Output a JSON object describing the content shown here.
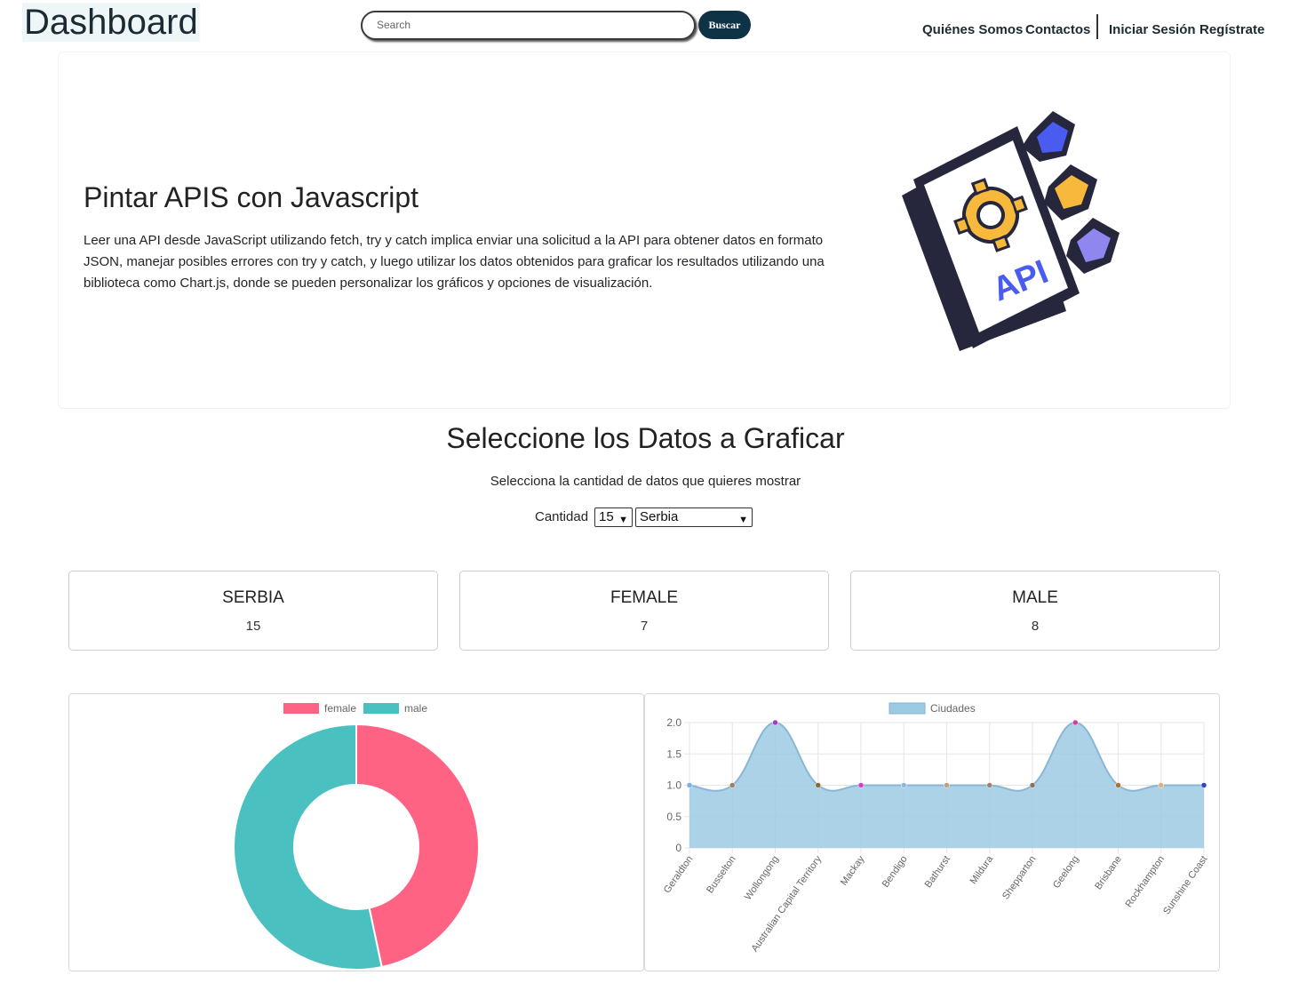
{
  "header": {
    "brand": "Dashboard",
    "search_placeholder": "Search",
    "search_button": "Buscar",
    "nav": [
      "Quiénes Somos",
      "Contactos",
      "Iniciar Sesión",
      "Regístrate"
    ]
  },
  "hero": {
    "title": "Pintar APIS con Javascript",
    "text": "Leer una API desde JavaScript utilizando fetch, try y catch implica enviar una solicitud a la API para obtener datos en formato JSON, manejar posibles errores con try y catch, y luego utilizar los datos obtenidos para graficar los resultados utilizando una biblioteca como Chart.js, donde se pueden personalizar los gráficos y opciones de visualización.",
    "illustration_label": "API"
  },
  "controls": {
    "title": "Seleccione los Datos a Graficar",
    "subtitle": "Selecciona la cantidad de datos que quieres mostrar",
    "quantity_label": "Cantidad",
    "quantity_value": "15",
    "country_value": "Serbia"
  },
  "cards": [
    {
      "title": "SERBIA",
      "value": "15"
    },
    {
      "title": "FEMALE",
      "value": "7"
    },
    {
      "title": "MALE",
      "value": "8"
    }
  ],
  "colors": {
    "female": "#ff6384",
    "male": "#4bc0c0",
    "area": "#9ccae3",
    "brand_dark": "#0f3346"
  },
  "chart_data": [
    {
      "type": "pie",
      "categories": [
        "female",
        "male"
      ],
      "values": [
        7,
        8
      ],
      "legend": "top"
    },
    {
      "type": "area",
      "series": [
        {
          "name": "Ciudades",
          "values": [
            1,
            1,
            2,
            1,
            1,
            1,
            1,
            1,
            1,
            2,
            1,
            1,
            1
          ]
        }
      ],
      "categories": [
        "Geraldton",
        "Busselton",
        "Wollongong",
        "Australian Capital Territory",
        "Mackay",
        "Bendigo",
        "Bathurst",
        "Mildura",
        "Shepparton",
        "Geelong",
        "Brisbane",
        "Rockhampton",
        "Sunshine Coast"
      ],
      "ylim": [
        0,
        2
      ],
      "yticks": [
        "2.0",
        "1.5",
        "1.0",
        "0.5",
        "0"
      ],
      "point_colors": [
        "#7ab0e6",
        "#a08060",
        "#a040c0",
        "#8a6a30",
        "#d040d0",
        "#8ab8e0",
        "#c0a080",
        "#a08070",
        "#8a7060",
        "#d040a0",
        "#b07030",
        "#e0b080",
        "#3040d0"
      ],
      "grid": true,
      "legend": "top"
    }
  ]
}
